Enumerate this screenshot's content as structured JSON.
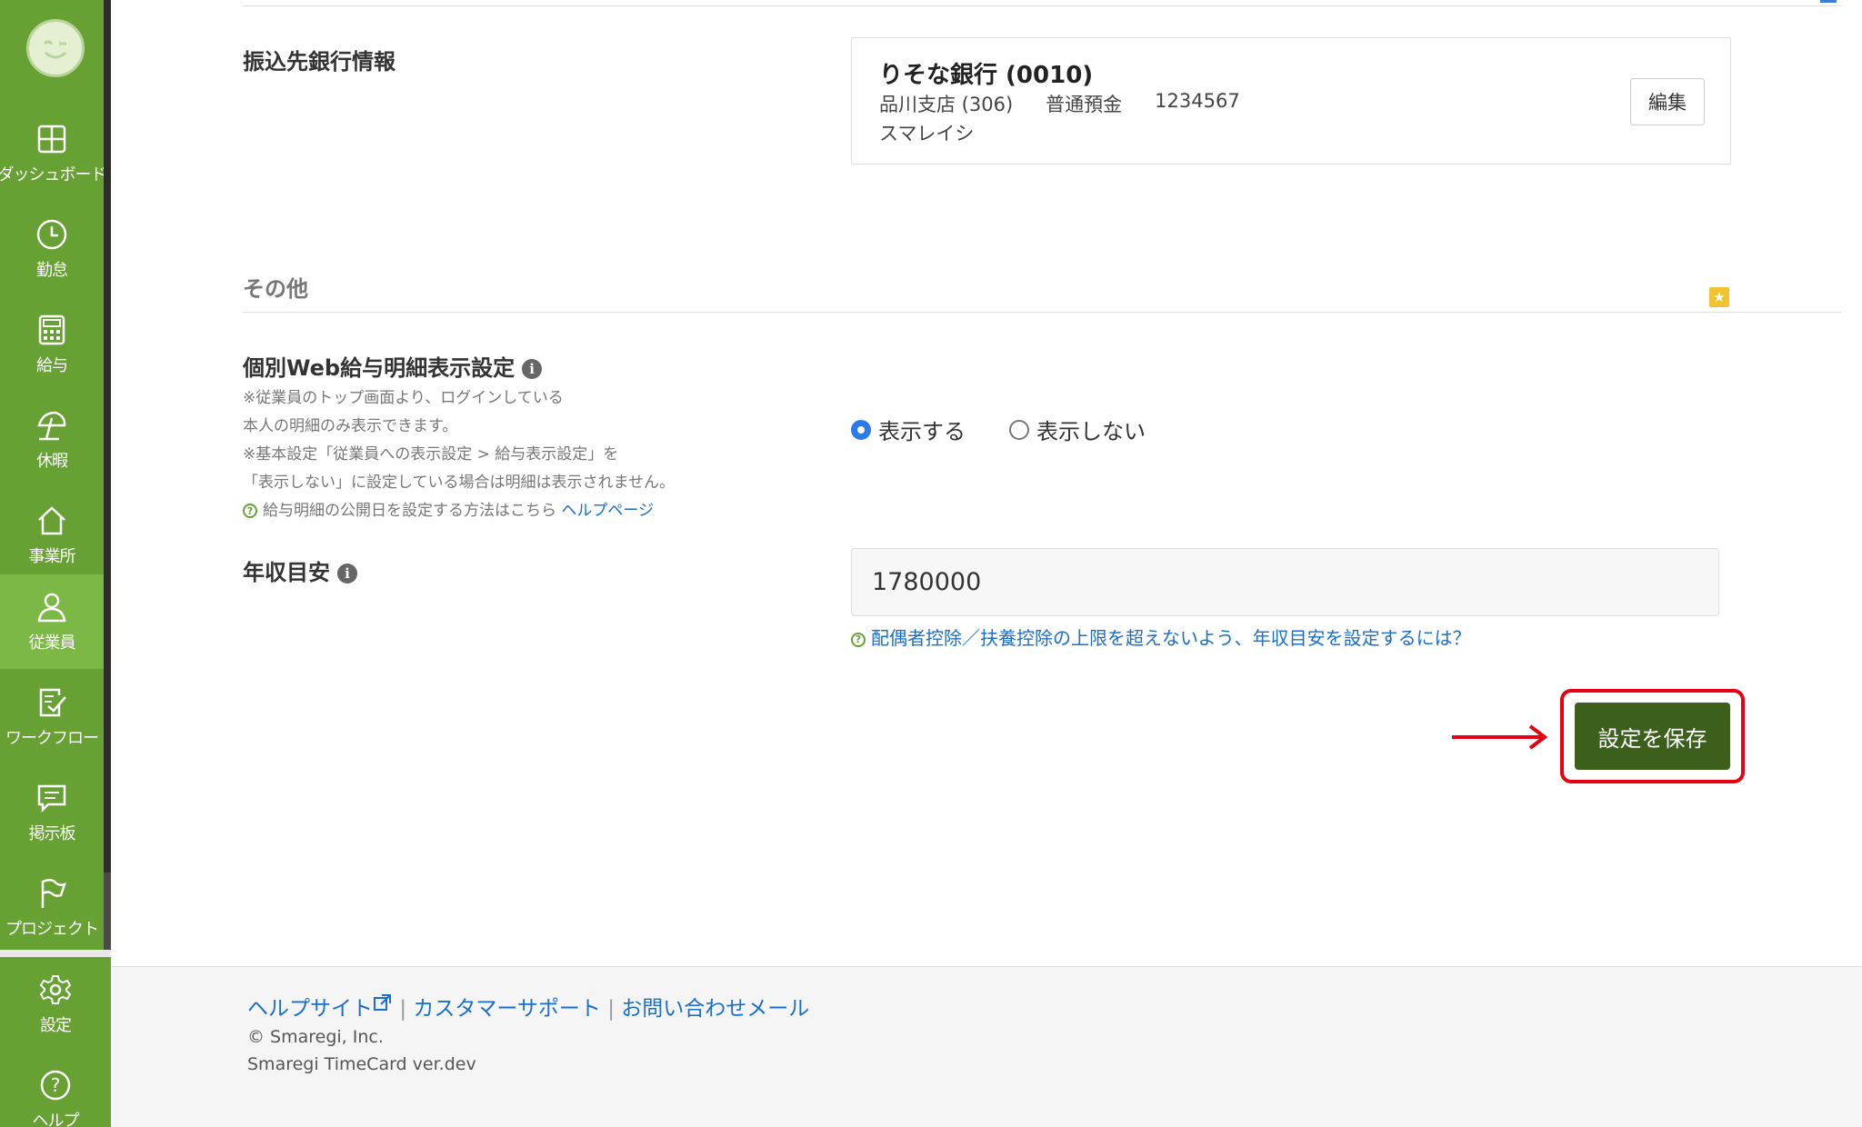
{
  "sidebar": {
    "items": [
      {
        "label": "ダッシュボード",
        "icon": "dashboard-icon"
      },
      {
        "label": "勤怠",
        "icon": "clock-icon"
      },
      {
        "label": "給与",
        "icon": "calculator-icon"
      },
      {
        "label": "休暇",
        "icon": "parasol-icon"
      },
      {
        "label": "事業所",
        "icon": "home-icon"
      },
      {
        "label": "従業員",
        "icon": "person-icon"
      },
      {
        "label": "ワークフロー",
        "icon": "checklist-icon"
      },
      {
        "label": "掲示板",
        "icon": "chat-icon"
      },
      {
        "label": "プロジェクト",
        "icon": "flag-icon"
      }
    ],
    "bottom": [
      {
        "label": "設定",
        "icon": "gear-icon"
      },
      {
        "label": "ヘルプ",
        "icon": "help-icon"
      }
    ],
    "active": "従業員"
  },
  "bank": {
    "label": "振込先銀行情報",
    "name": "りそな銀行 (0010)",
    "branch": "品川支店 (306)",
    "type": "普通預金",
    "account": "1234567",
    "holder": "スマレイシ",
    "edit_label": "編集"
  },
  "other": {
    "section_title": "その他",
    "payslip_label": "個別Web給与明細表示設定",
    "notes": [
      "※従業員のトップ画面より、ログインしている",
      "本人の明細のみ表示できます。",
      "※基本設定「従業員への表示設定 > 給与表示設定」を",
      "「表示しない」に設定している場合は明細は表示されません。"
    ],
    "help_text": "給与明細の公開日を設定する方法はこちら",
    "help_link": "ヘルプページ",
    "radio_show": "表示する",
    "radio_hide": "表示しない",
    "selected": "表示する",
    "income_label": "年収目安",
    "income_value": "1780000",
    "income_help": "配偶者控除／扶養控除の上限を超えないよう、年収目安を設定するには？",
    "save_label": "設定を保存"
  },
  "footer": {
    "link_help": "ヘルプサイト",
    "link_support": "カスタマーサポート",
    "link_mail": "お問い合わせメール",
    "separator": "|",
    "copyright": "© Smaregi, Inc.",
    "version": "Smaregi TimeCard ver.dev"
  },
  "colors": {
    "sidebar": "#67a134",
    "sidebar_active": "#7cb845",
    "save_button": "#3d5f1c",
    "highlight": "#e60012",
    "link": "#1a6fc9"
  }
}
